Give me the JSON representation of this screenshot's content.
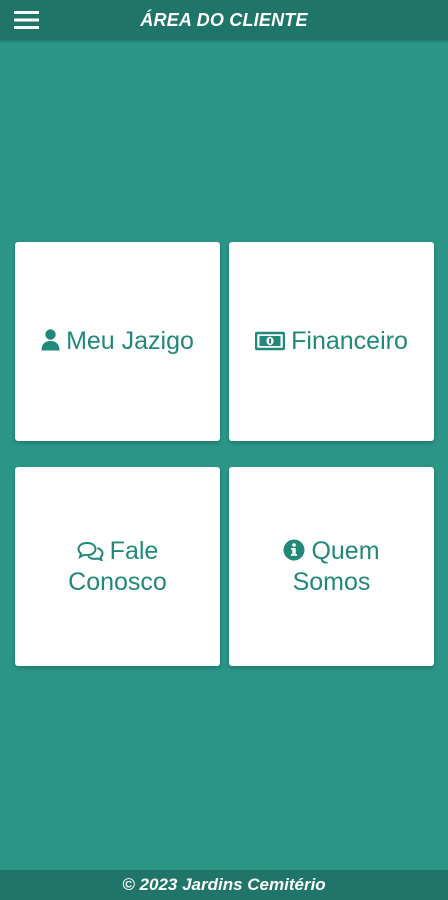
{
  "header": {
    "title": "ÁREA DO CLIENTE",
    "menu_icon": "hamburger-menu-icon"
  },
  "tiles": [
    {
      "icon": "user-icon",
      "label_line1": "Meu Jazigo",
      "label_line2": ""
    },
    {
      "icon": "money-bill-icon",
      "label_line1": "Financeiro",
      "label_line2": ""
    },
    {
      "icon": "chat-bubbles-icon",
      "label_line1": "Fale",
      "label_line2": "Conosco"
    },
    {
      "icon": "info-circle-icon",
      "label_line1": "Quem",
      "label_line2": "Somos"
    }
  ],
  "footer": {
    "text": "©  2023  Jardins Cemitério"
  },
  "colors": {
    "background": "#2b9688",
    "bar": "#1f7568",
    "accent": "#21887a",
    "card": "#ffffff"
  }
}
